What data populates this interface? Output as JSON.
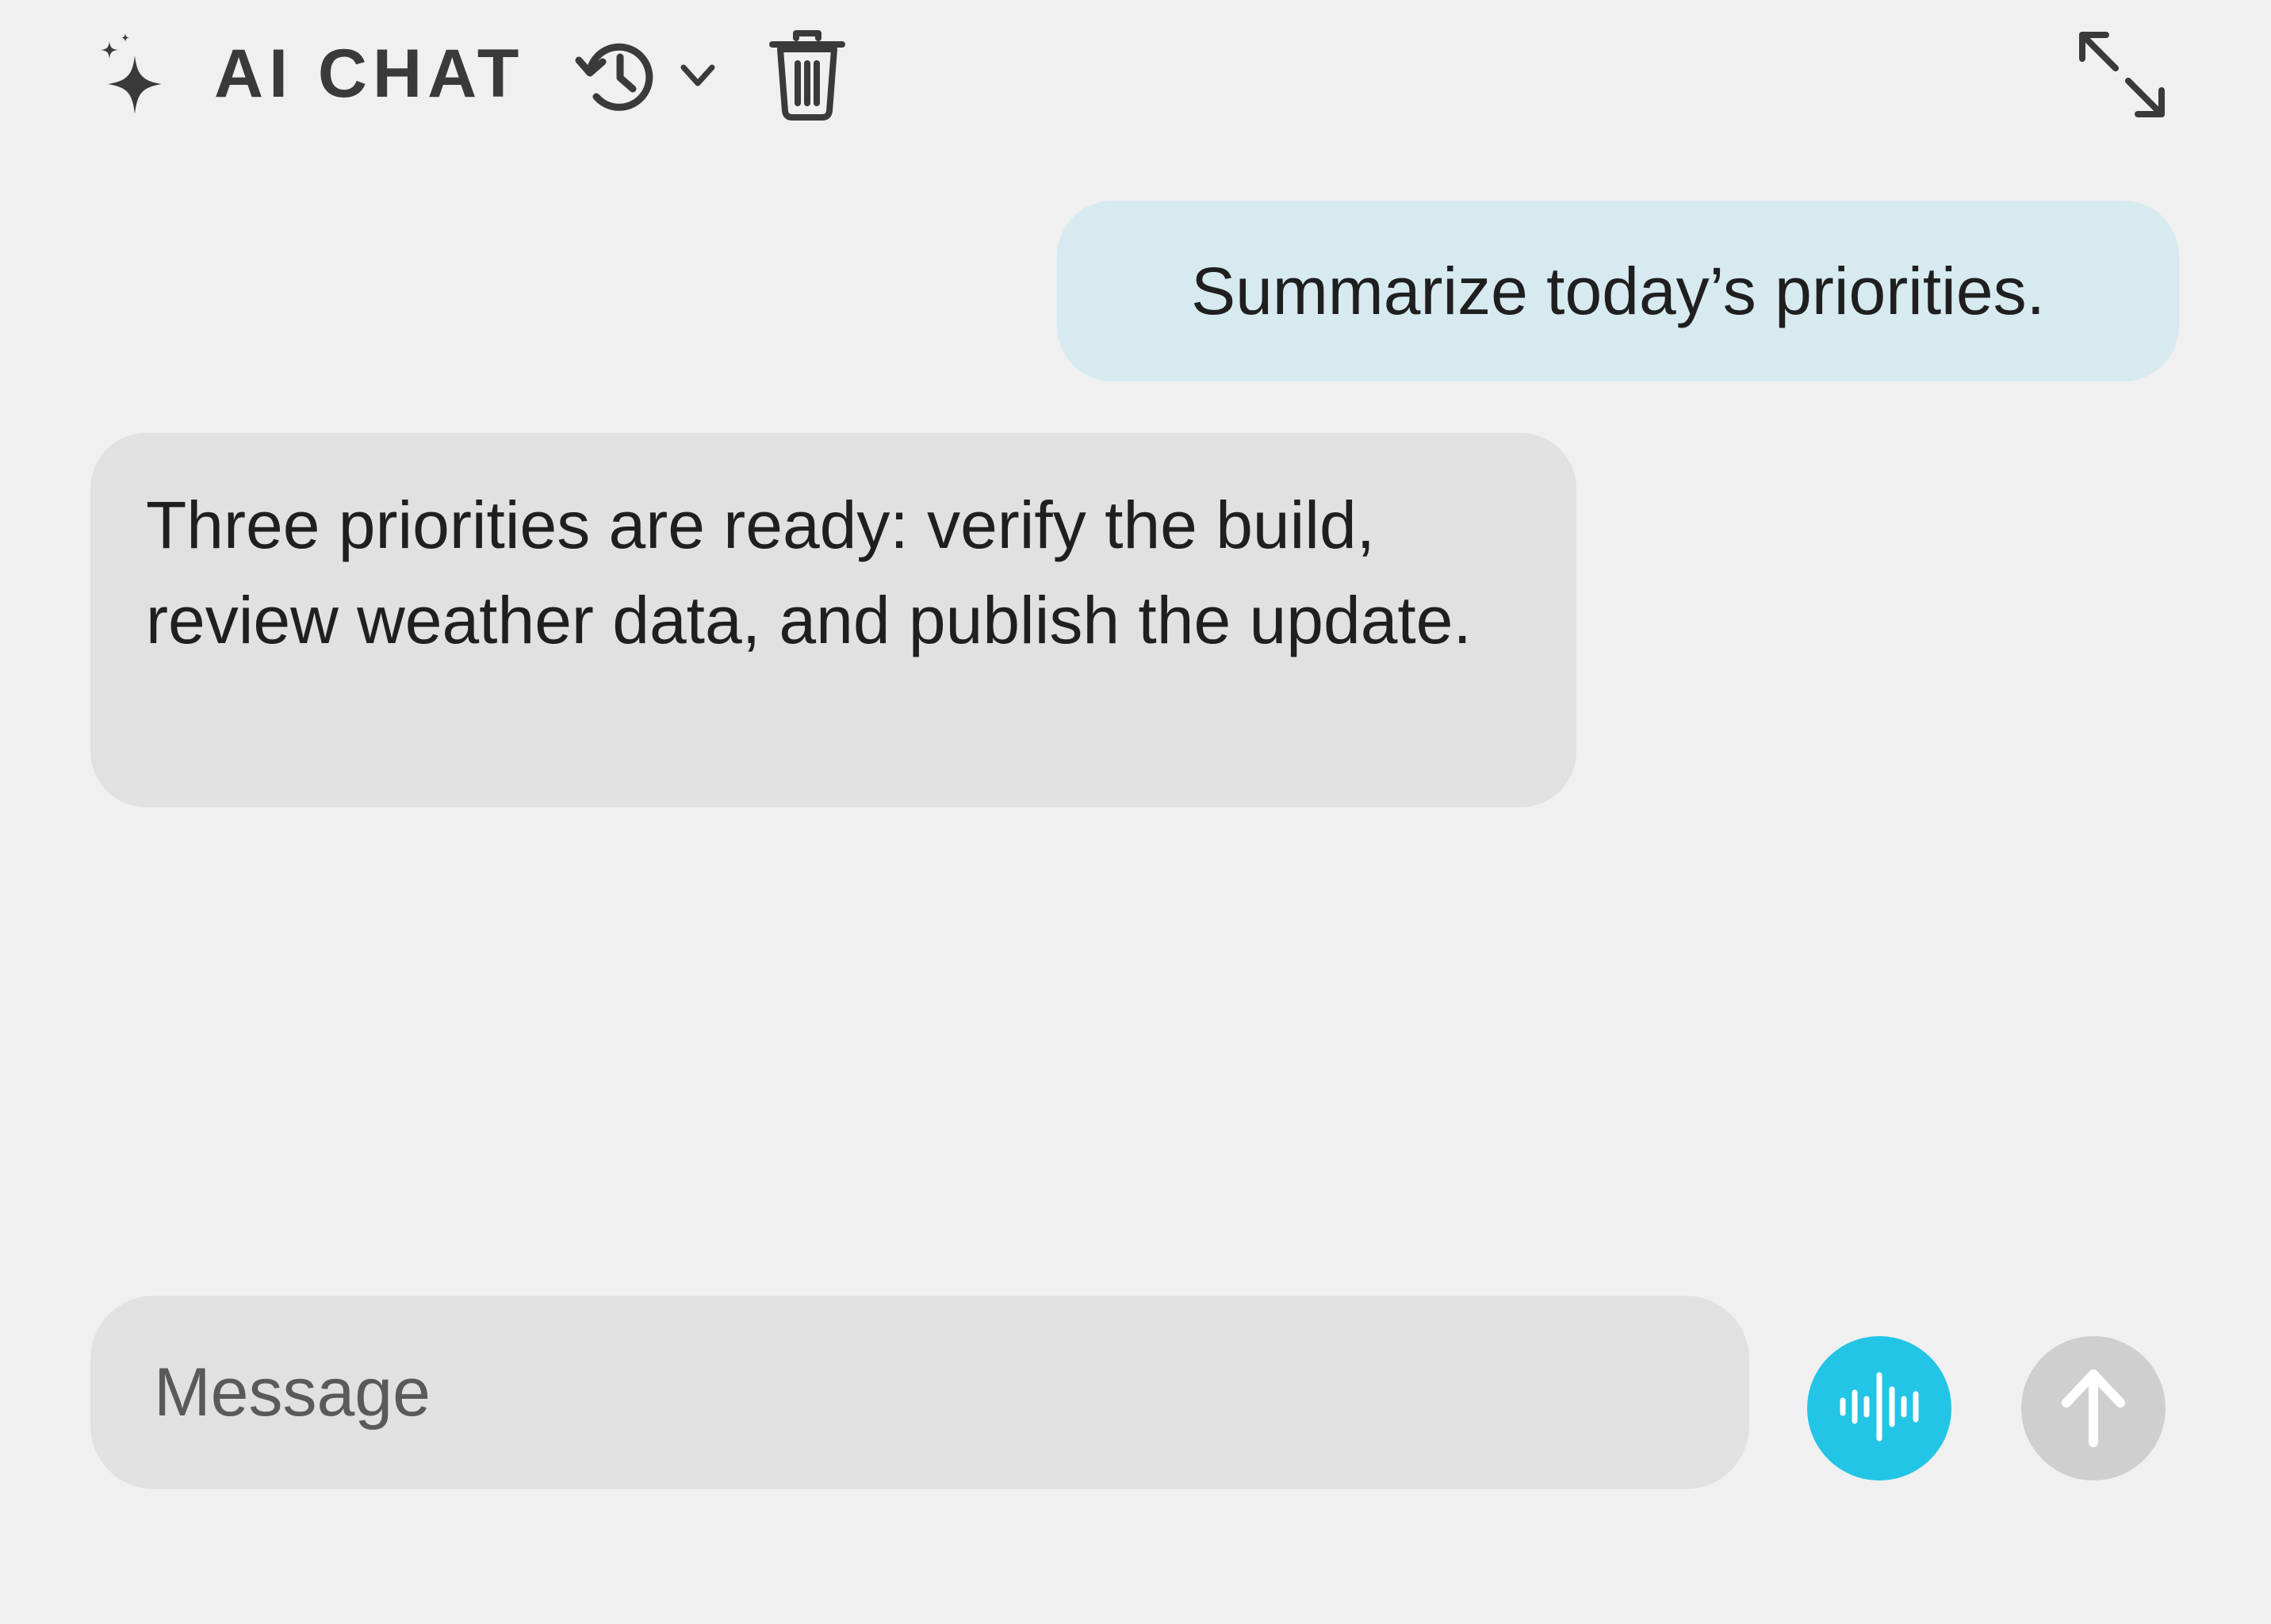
{
  "header": {
    "title": "AI CHAT",
    "icons": {
      "sparkle": "sparkle-icon",
      "history": "history-icon",
      "history_menu": "chevron-down-icon",
      "delete": "trash-icon",
      "expand": "expand-icon"
    }
  },
  "messages": [
    {
      "role": "user",
      "text": "Summarize today’s priorities."
    },
    {
      "role": "assistant",
      "text": "Three priorities are ready: verify the build, review weather data, and publish the update."
    }
  ],
  "composer": {
    "placeholder": "Message",
    "value": "",
    "voice_icon": "waveform-icon",
    "send_icon": "arrow-up-icon"
  },
  "colors": {
    "background": "#f0f0f0",
    "user_bubble": "#d6eaf0",
    "assistant_bubble": "#e1e1e1",
    "accent": "#23c5e6",
    "send_disabled": "#cfcfcf",
    "icon": "#3a3a3a"
  }
}
